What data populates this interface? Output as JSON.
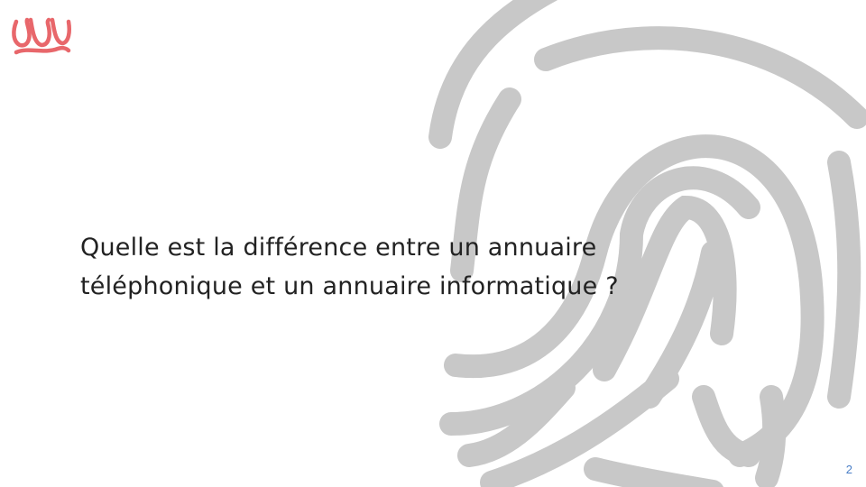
{
  "slide": {
    "question_line1": "Quelle est la différence entre un annuaire",
    "question_line2": "téléphonique et un annuaire informatique ?",
    "page_number": "2"
  },
  "decor": {
    "logo_icon": "wavy-w-logo-icon",
    "background_icon": "fingerprint-icon"
  },
  "colors": {
    "logo": "#e8676b",
    "fingerprint": "#c8c8c8",
    "text": "#222222",
    "page_number": "#4a7fc7"
  }
}
